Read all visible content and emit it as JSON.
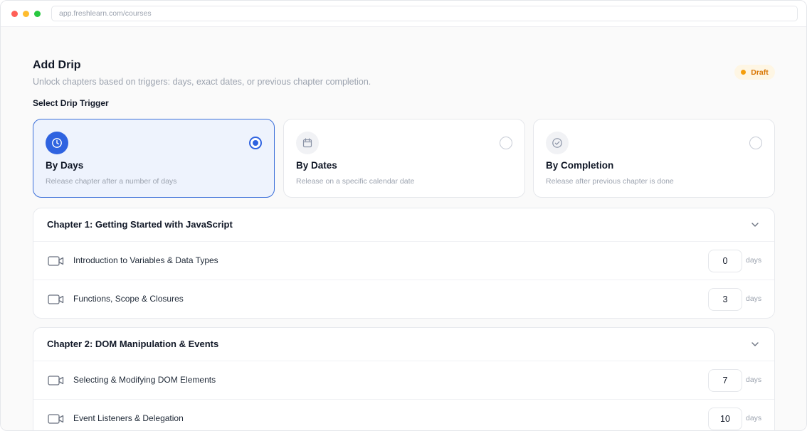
{
  "browser": {
    "url": "app.freshlearn.com/courses"
  },
  "header": {
    "title": "Add Drip",
    "subtitle": "Unlock chapters based on triggers: days, exact dates, or previous chapter completion.",
    "status_badge": "Draft"
  },
  "trigger_section": {
    "label": "Select Drip Trigger",
    "options": [
      {
        "title": "By Days",
        "description": "Release chapter after a number of days",
        "icon": "clock-icon",
        "selected": true
      },
      {
        "title": "By Dates",
        "description": "Release on a specific calendar date",
        "icon": "calendar-icon",
        "selected": false
      },
      {
        "title": "By Completion",
        "description": "Release after previous chapter is done",
        "icon": "check-circle-icon",
        "selected": false
      }
    ]
  },
  "chapters": [
    {
      "title": "Chapter 1: Getting Started with JavaScript",
      "lessons": [
        {
          "title": "Introduction to Variables & Data Types",
          "days": "0",
          "unit": "days"
        },
        {
          "title": "Functions, Scope & Closures",
          "days": "3",
          "unit": "days"
        }
      ]
    },
    {
      "title": "Chapter 2: DOM Manipulation & Events",
      "lessons": [
        {
          "title": "Selecting & Modifying DOM Elements",
          "days": "7",
          "unit": "days"
        },
        {
          "title": "Event Listeners & Delegation",
          "days": "10",
          "unit": "days"
        }
      ]
    }
  ],
  "colors": {
    "accent": "#2f63e0",
    "selected_bg": "#eef3fd",
    "draft_text": "#d97706",
    "draft_bg": "#fef6e4"
  }
}
